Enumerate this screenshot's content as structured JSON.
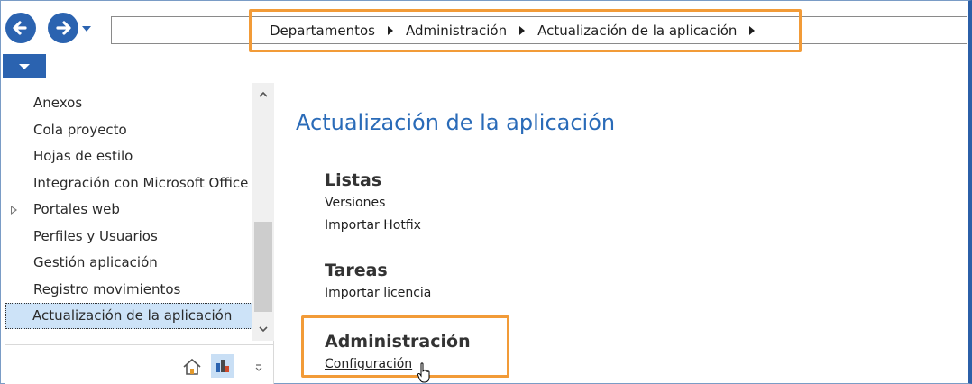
{
  "toolbar": {
    "back_icon": "arrow-left-icon",
    "forward_icon": "arrow-right-icon",
    "history_dropdown_icon": "chevron-down-icon",
    "accent_color": "#2b63b0",
    "breadcrumb": [
      "Departamentos",
      "Administración",
      "Actualización de la aplicación"
    ],
    "highlight_color": "#f29b38"
  },
  "sidebar": {
    "items": [
      {
        "label": "Anexos",
        "expandable": false,
        "selected": false
      },
      {
        "label": "Cola proyecto",
        "expandable": false,
        "selected": false
      },
      {
        "label": "Hojas de estilo",
        "expandable": false,
        "selected": false
      },
      {
        "label": "Integración con Microsoft Office",
        "expandable": false,
        "selected": false
      },
      {
        "label": "Portales web",
        "expandable": true,
        "selected": false
      },
      {
        "label": "Perfiles y Usuarios",
        "expandable": false,
        "selected": false
      },
      {
        "label": "Gestión aplicación",
        "expandable": false,
        "selected": false
      },
      {
        "label": "Registro movimientos",
        "expandable": false,
        "selected": false
      },
      {
        "label": "Actualización de la aplicación",
        "expandable": false,
        "selected": true
      }
    ],
    "footer_icons": [
      "home-icon",
      "chart-icon",
      "more-icon"
    ]
  },
  "main": {
    "title": "Actualización de la aplicación",
    "title_color": "#2a6bb8",
    "sections": [
      {
        "title": "Listas",
        "links": [
          "Versiones",
          "Importar Hotfix"
        ]
      },
      {
        "title": "Tareas",
        "links": [
          "Importar licencia"
        ]
      },
      {
        "title": "Administración",
        "links": [
          "Configuración"
        ]
      }
    ]
  }
}
